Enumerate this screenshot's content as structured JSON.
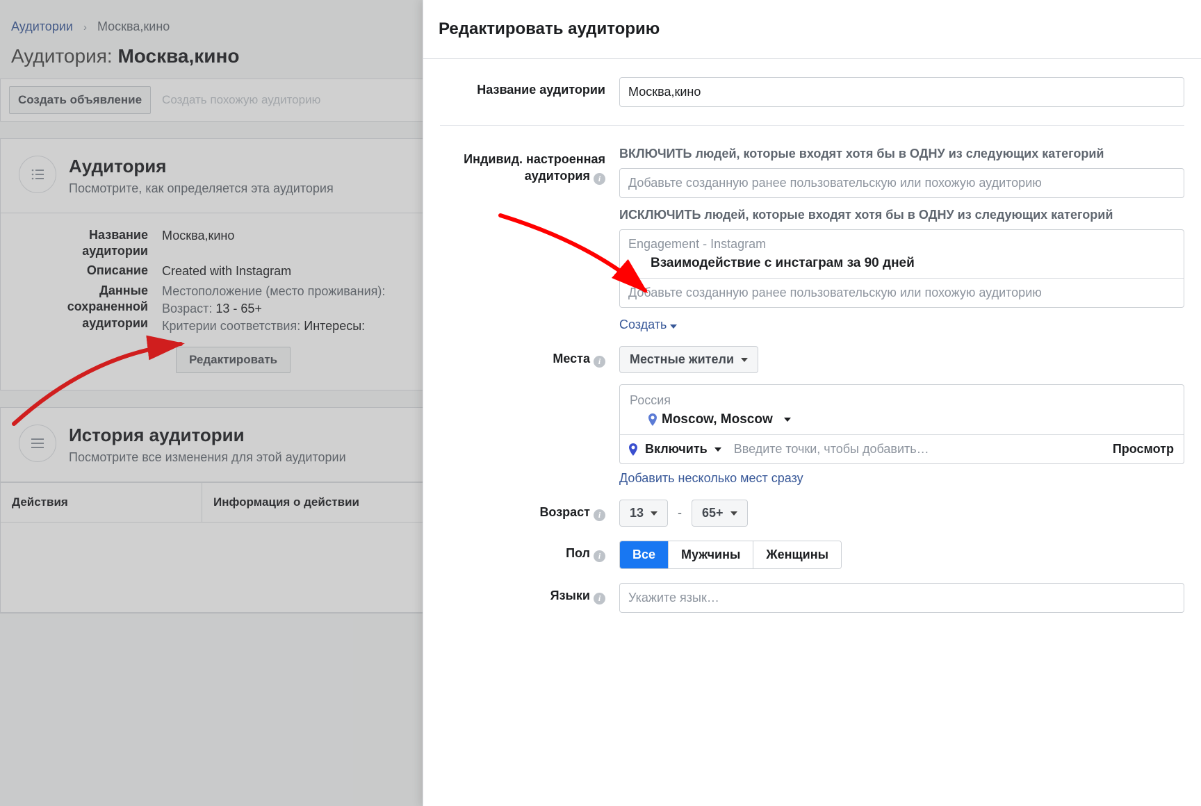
{
  "breadcrumb": {
    "root": "Аудитории",
    "current": "Москва,кино"
  },
  "page_title_prefix": "Аудитория: ",
  "page_title_name": "Москва,кино",
  "buttons": {
    "create_ad": "Создать объявление",
    "create_lookalike": "Создать похожую аудиторию",
    "edit": "Редактировать"
  },
  "audience_card": {
    "title": "Аудитория",
    "subtitle": "Посмотрите, как определяется эта аудитория",
    "labels": {
      "name": "Название аудитории",
      "desc": "Описание",
      "data": "Данные сохраненной аудитории"
    },
    "values": {
      "name": "Москва,кино",
      "desc": "Created with Instagram",
      "location_prefix": "Местоположение (место проживания):",
      "age_prefix": "Возраст:",
      "age_value": "13 - 65+",
      "criteria_prefix": "Критерии соответствия:",
      "criteria_value": "Интересы:"
    }
  },
  "history_card": {
    "title": "История аудитории",
    "subtitle": "Посмотрите все изменения для этой аудитории"
  },
  "table": {
    "col1": "Действия",
    "col2": "Информация о действии"
  },
  "modal": {
    "title": "Редактировать аудиторию",
    "labels": {
      "name": "Название аудитории",
      "custom": "Индивид. настроенная аудитория",
      "places": "Места",
      "age": "Возраст",
      "gender": "Пол",
      "lang": "Языки"
    },
    "name_value": "Москва,кино",
    "include_title": "ВКЛЮЧИТЬ людей, которые входят хотя бы в ОДНУ из следующих категорий",
    "exclude_title": "ИСКЛЮЧИТЬ людей, которые входят хотя бы в ОДНУ из следующих категорий",
    "aud_placeholder": "Добавьте созданную ранее пользовательскую или похожую аудиторию",
    "exclude_group_head": "Engagement - Instagram",
    "exclude_chip": "Взаимодействие с инстаграм за 90 дней",
    "create_link": "Создать",
    "places_mode": "Местные жители",
    "country": "Россия",
    "city": "Moscow, Moscow",
    "include_text": "Включить",
    "places_placeholder": "Введите точки, чтобы добавить…",
    "preview": "Просмотр",
    "add_many": "Добавить несколько мест сразу",
    "age_from": "13",
    "age_to": "65+",
    "gender_options": [
      "Все",
      "Мужчины",
      "Женщины"
    ],
    "lang_placeholder": "Укажите язык…"
  }
}
